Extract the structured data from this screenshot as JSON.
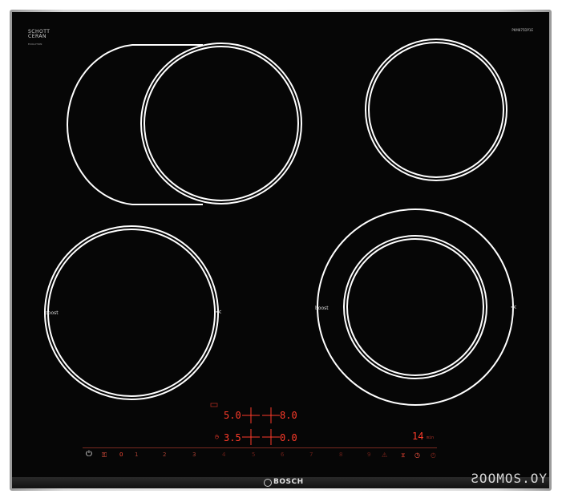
{
  "brand": {
    "name": "SCHOTT",
    "material": "CERAN",
    "sub": "ECOLUTION"
  },
  "model": "PKM875DP1E",
  "logo": "BOSCH",
  "watermark": "ƧOOMOS.OY",
  "zones": {
    "front_left": {
      "boost": "boost",
      "chevron": "≪"
    },
    "front_right": {
      "boost": "boost",
      "chevron": "≪"
    }
  },
  "displays": {
    "rear_left_value": "5.0",
    "rear_right_value": "8.0",
    "front_left_value": "3.5",
    "front_right_value": "0.0",
    "timer_value": "14",
    "timer_unit": "min"
  },
  "scale": [
    "0",
    "1",
    "2",
    "3",
    "4",
    "5",
    "6",
    "7",
    "8",
    "9"
  ],
  "colors": {
    "glass": "#060606",
    "led": "#ff3b2a",
    "ring": "#ffffff"
  },
  "icons": [
    "power-icon",
    "childlock-icon",
    "timer-icon",
    "clock-icon",
    "boost-icon"
  ]
}
